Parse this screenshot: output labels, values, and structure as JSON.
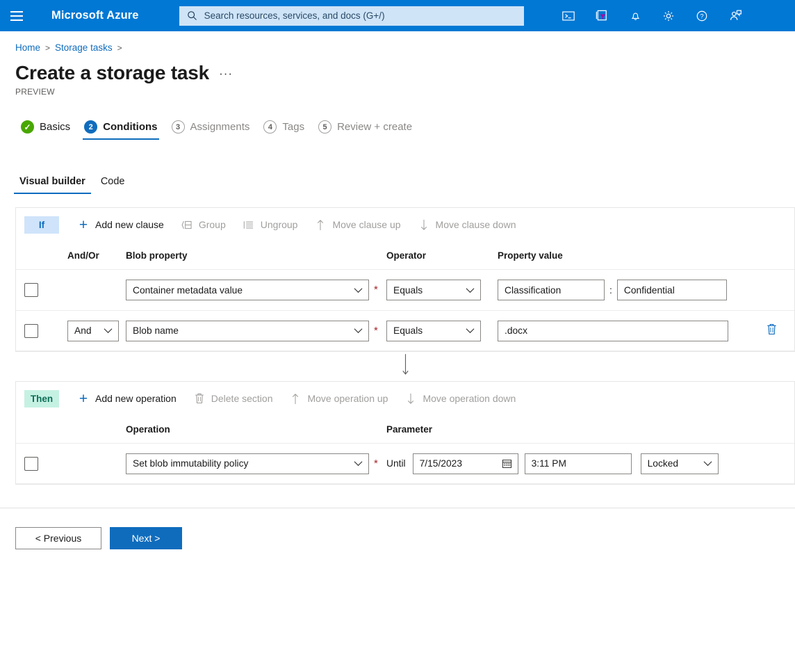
{
  "topbar": {
    "menu_icon": "hamburger-icon",
    "brand": "Microsoft Azure",
    "search_placeholder": "Search resources, services, and docs (G+/)",
    "search_value": "",
    "icons": [
      {
        "name": "cloud-shell-icon",
        "label": "Cloud Shell"
      },
      {
        "name": "directories-subscriptions-icon",
        "label": "Directories + subscriptions"
      },
      {
        "name": "notifications-bell-icon",
        "label": "Notifications"
      },
      {
        "name": "settings-gear-icon",
        "label": "Settings"
      },
      {
        "name": "help-question-icon",
        "label": "Help"
      },
      {
        "name": "feedback-person-icon",
        "label": "Feedback"
      }
    ]
  },
  "breadcrumb": {
    "items": [
      "Home",
      "Storage tasks"
    ],
    "separator": ">"
  },
  "header": {
    "title": "Create a storage task",
    "more_label": "···",
    "preview": "PREVIEW"
  },
  "steps": [
    {
      "marker": "✓",
      "label": "Basics",
      "state": "done"
    },
    {
      "marker": "2",
      "label": "Conditions",
      "state": "active"
    },
    {
      "marker": "3",
      "label": "Assignments",
      "state": "pending"
    },
    {
      "marker": "4",
      "label": "Tags",
      "state": "pending"
    },
    {
      "marker": "5",
      "label": "Review + create",
      "state": "pending"
    }
  ],
  "subtabs": [
    {
      "label": "Visual builder",
      "active": true
    },
    {
      "label": "Code",
      "active": false
    }
  ],
  "if_section": {
    "badge": "If",
    "toolbar": [
      {
        "label": "Add new clause",
        "icon": "plus-icon",
        "disabled": false
      },
      {
        "label": "Group",
        "icon": "group-icon",
        "disabled": true
      },
      {
        "label": "Ungroup",
        "icon": "ungroup-icon",
        "disabled": true
      },
      {
        "label": "Move clause up",
        "icon": "arrow-up-icon",
        "disabled": true
      },
      {
        "label": "Move clause down",
        "icon": "arrow-down-icon",
        "disabled": true
      }
    ],
    "columns": {
      "andor": "And/Or",
      "property": "Blob property",
      "operator": "Operator",
      "value": "Property value"
    },
    "rows": [
      {
        "checked": false,
        "andor": "",
        "property": "Container metadata value",
        "operator": "Equals",
        "value_key": "Classification",
        "value_sep": ":",
        "value_val": "Confidential",
        "required": "*",
        "has_delete": false
      },
      {
        "checked": false,
        "andor": "And",
        "property": "Blob name",
        "operator": "Equals",
        "value_val": ".docx",
        "required": "*",
        "has_delete": true,
        "delete_icon": "trash-icon"
      }
    ]
  },
  "connector": {
    "icon": "down-arrow-icon"
  },
  "then_section": {
    "badge": "Then",
    "toolbar": [
      {
        "label": "Add new operation",
        "icon": "plus-icon",
        "disabled": false
      },
      {
        "label": "Delete section",
        "icon": "trash-icon",
        "disabled": true
      },
      {
        "label": "Move operation up",
        "icon": "arrow-up-icon",
        "disabled": true
      },
      {
        "label": "Move operation down",
        "icon": "arrow-down-icon",
        "disabled": true
      }
    ],
    "columns": {
      "operation": "Operation",
      "parameter": "Parameter"
    },
    "rows": [
      {
        "checked": false,
        "operation": "Set blob immutability policy",
        "required": "*",
        "until_label": "Until",
        "date": "7/15/2023",
        "date_icon": "calendar-icon",
        "time": "3:11 PM",
        "lock_mode": "Locked"
      }
    ]
  },
  "footer": {
    "previous": "< Previous",
    "next": "Next >"
  },
  "colors": {
    "azure_blue": "#0078d4",
    "link_blue": "#0f6cbd",
    "if_badge_bg": "#cfe4fa",
    "then_badge_bg": "#c5f1e3",
    "success_green": "#49a700",
    "required_red": "#a4262c"
  }
}
